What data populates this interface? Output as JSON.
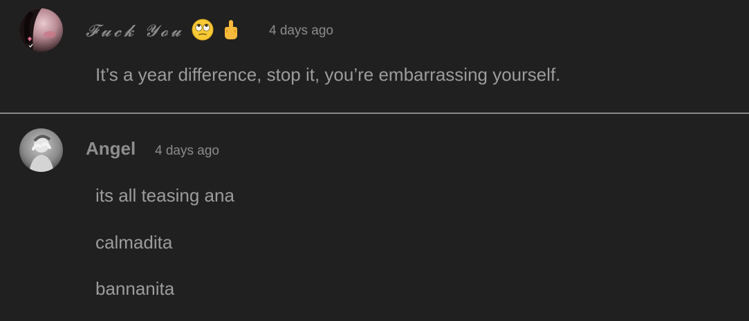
{
  "comments": [
    {
      "username": "𝓕𝓾𝓬𝓴 𝓨𝓸𝓾",
      "timestamp": "4 days ago",
      "lines": [
        "It’s a year difference, stop it, you’re embarrassing yourself."
      ],
      "avatar_icon": "profile-photo"
    },
    {
      "username": "Angel",
      "timestamp": "4 days ago",
      "lines": [
        "its all teasing ana",
        "calmadita",
        "bannanita"
      ],
      "avatar_icon": "profile-photo"
    }
  ],
  "emojis": [
    "face-with-rolling-eyes",
    "middle-finger"
  ],
  "colors": {
    "background": "#202020",
    "text": "#9a9a9a",
    "divider": "#8a8a8a"
  }
}
